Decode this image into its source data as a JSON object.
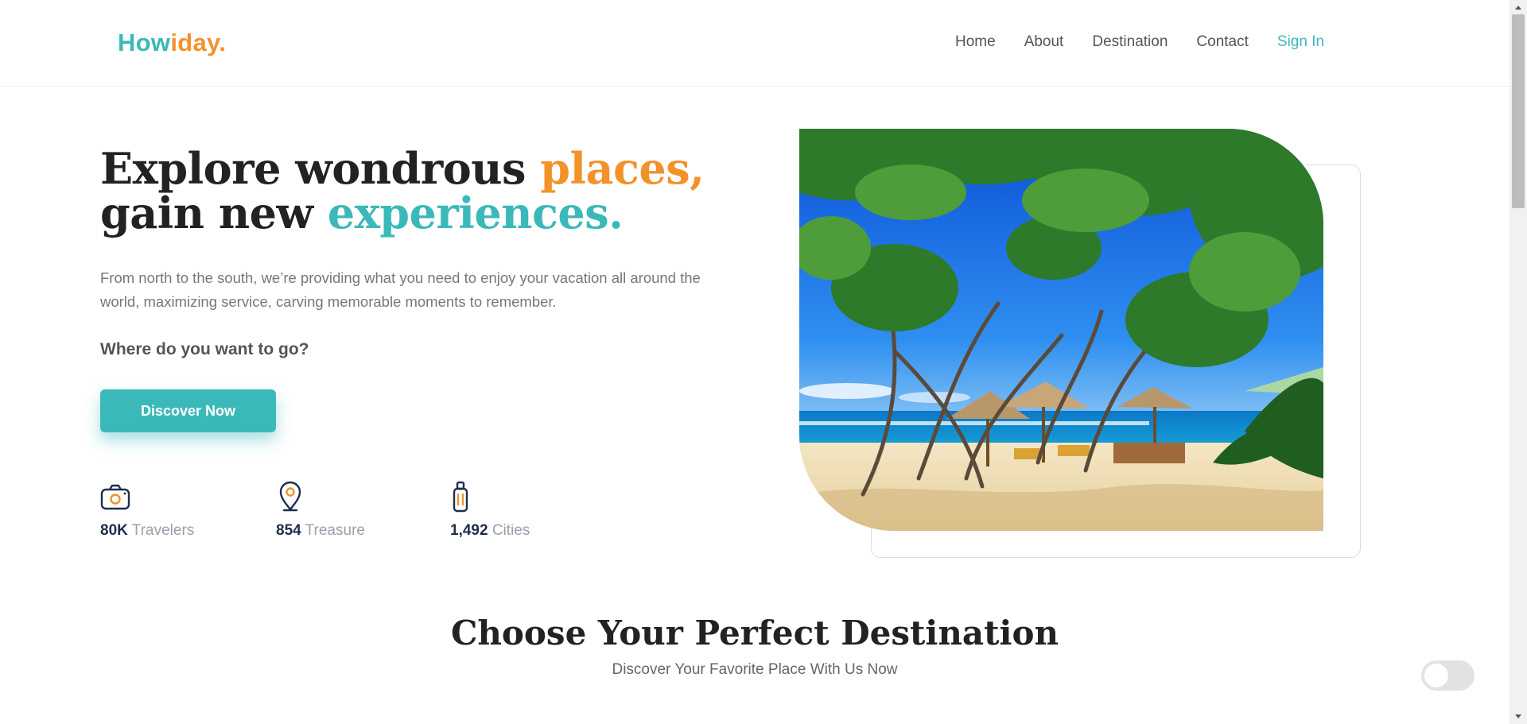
{
  "header": {
    "logo_part1": "How",
    "logo_part2": "iday.",
    "nav": [
      {
        "label": "Home"
      },
      {
        "label": "About"
      },
      {
        "label": "Destination"
      },
      {
        "label": "Contact"
      },
      {
        "label": "Sign In"
      }
    ]
  },
  "hero": {
    "title_1": "Explore wondrous ",
    "title_highlight_1": "places,",
    "title_2": " gain new ",
    "title_highlight_2": "experiences.",
    "description": "From north to the south, we’re providing what you need to enjoy your vacation all around the world, maximizing service, carving memorable moments to remember.",
    "question": "Where do you want to go?",
    "button_label": "Discover Now",
    "stats": [
      {
        "value": "80K",
        "label": "Travelers",
        "icon": "camera-icon"
      },
      {
        "value": "854",
        "label": "Treasure",
        "icon": "map-pin-icon"
      },
      {
        "value": "1,492",
        "label": "Cities",
        "icon": "luggage-icon"
      }
    ],
    "image": "tropical-beach-photo"
  },
  "section": {
    "title": "Choose Your Perfect Destination",
    "subtitle": "Discover Your Favorite Place With Us Now"
  },
  "theme_toggle": {
    "state": "off"
  },
  "colors": {
    "teal": "#3bb9ba",
    "orange": "#f3922a",
    "navy": "#1f2d4d"
  }
}
